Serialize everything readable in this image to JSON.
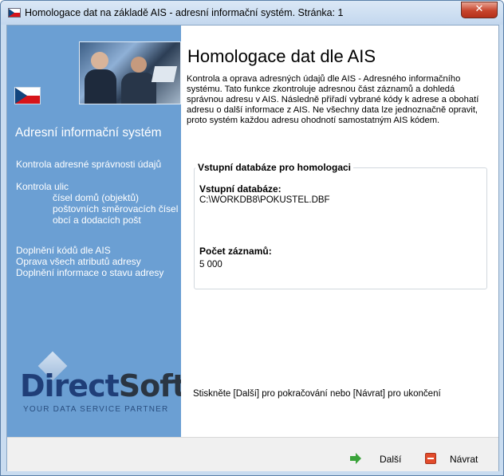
{
  "window": {
    "title": "Homologace dat na základě AIS - adresní informační systém. Stránka: 1",
    "close_glyph": "✕"
  },
  "sidebar": {
    "heading": "Adresní informační systém",
    "items": [
      "Kontrola adresné správnosti údajů",
      "Kontrola ulic",
      "čísel domů (objektů)",
      "poštovních směrovacích čísel",
      "obcí  a dodacích pošt",
      "Doplnění kódů dle AIS",
      "Oprava všech atributů adresy",
      "Doplnění informace o stavu adresy"
    ],
    "logo": {
      "part1": "Direct",
      "part2": "Soft",
      "tagline": "YOUR DATA SERVICE PARTNER"
    },
    "flag_colors": {
      "white": "#ffffff",
      "red": "#d7141a",
      "blue": "#11457e"
    }
  },
  "main": {
    "title": "Homologace dat dle AIS",
    "intro": "Kontrola a oprava adresných údajů dle AIS - Adresného informačního systému. Tato funkce zkontroluje adresnou část záznamů a dohledá správnou adresu v AIS. Následně přiřadí vybrané kódy k adrese a obohatí adresu o další informace z AIS. Ne všechny data lze jednoznačně opravit, proto systém každou adresu ohodnotí samostatným AIS kódem.",
    "group": {
      "legend": "Vstupní databáze pro homologaci",
      "db_label": "Vstupní databáze:",
      "db_value": "C:\\WORKDB8\\POKUSTEL.DBF",
      "count_label": "Počet záznamů:",
      "count_value": "5 000"
    },
    "hint": "Stiskněte [Další] pro pokračování nebo [Návrat] pro ukončení"
  },
  "footer": {
    "next_label": "Další",
    "back_label": "Návrat"
  },
  "colors": {
    "sidebar_bg": "#6b9fd3",
    "accent_green": "#3aa33a",
    "exit_red": "#e24b2b"
  }
}
